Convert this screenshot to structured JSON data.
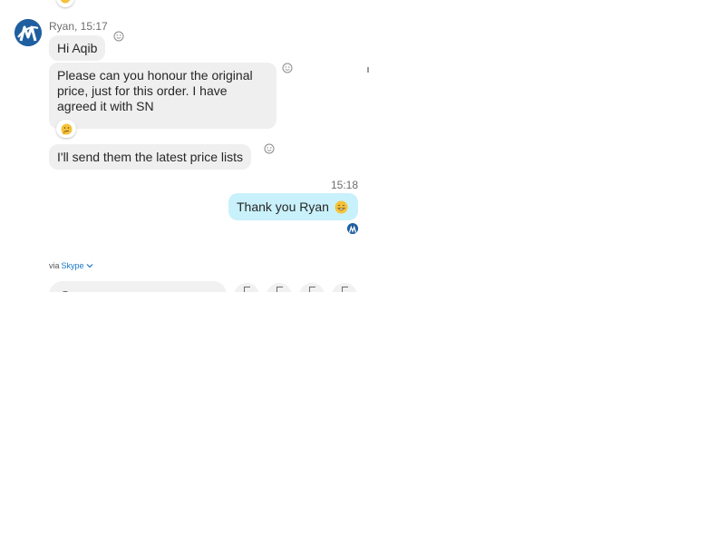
{
  "chat": {
    "messages_in": {
      "sender": "Ryan",
      "time": "15:17",
      "sender_line": "Ryan, 15:17",
      "items": [
        {
          "text": "Hi Aqib"
        },
        {
          "text": "Please can you honour the original price, just for this order. I have agreed it with SN",
          "reaction": "thinking"
        },
        {
          "text": "I'll send them the latest price lists"
        }
      ]
    },
    "messages_out": {
      "time": "15:18",
      "text": "Thank you Ryan",
      "emoji": "smile"
    },
    "via": {
      "prefix": "via",
      "link": "Skype"
    }
  },
  "icons": {
    "avatar": "company-logo-avatar",
    "react": "smile-outline-icon",
    "chevron": "chevron-down-icon"
  },
  "colors": {
    "incoming_bubble": "#efefef",
    "outgoing_bubble": "#c9f1fb",
    "link": "#1877c9",
    "avatar": "#1f5fa0"
  }
}
